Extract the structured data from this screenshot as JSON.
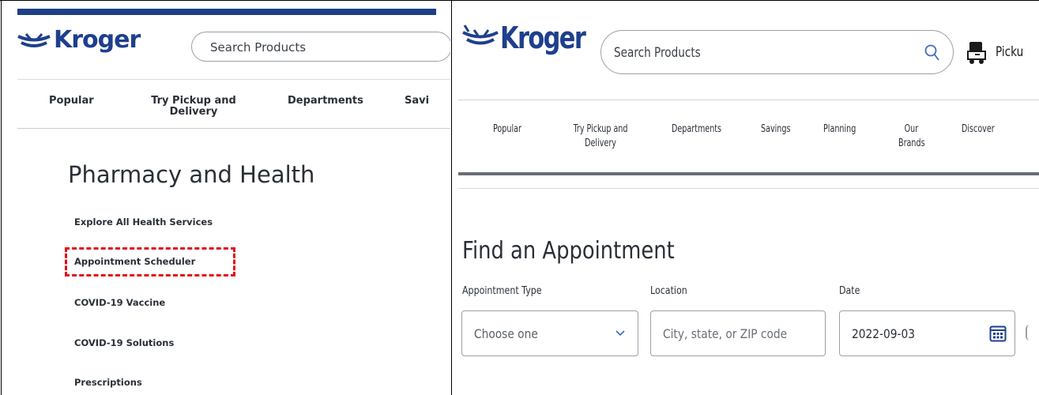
{
  "left_pane": {
    "brand": "Kroger",
    "search": {
      "placeholder": "Search Products"
    },
    "nav": [
      "Popular",
      "Try Pickup and Delivery",
      "Departments",
      "Savi"
    ],
    "page_title": "Pharmacy and Health",
    "links": [
      "Explore All Health Services",
      "Appointment Scheduler",
      "COVID-19 Vaccine",
      "COVID-19 Solutions",
      "Prescriptions"
    ],
    "highlight_color": "#e0101a"
  },
  "right_pane": {
    "brand": "Kroger",
    "search": {
      "placeholder": "Search Products"
    },
    "pickup_label": "Picku",
    "nav": [
      "Popular",
      "Try Pickup and Delivery",
      "Departments",
      "Savings",
      "Planning",
      "Our Brands",
      "Discover"
    ],
    "title": "Find an Appointment",
    "form": {
      "appointment_type": {
        "label": "Appointment Type",
        "value": "Choose one"
      },
      "location": {
        "label": "Location",
        "placeholder": "City, state, or ZIP code"
      },
      "date": {
        "label": "Date",
        "value": "2022-09-03"
      }
    }
  },
  "colors": {
    "brand_blue": "#1e3f8c",
    "text_dark": "#2a2f38",
    "border": "#9aa0a8"
  }
}
